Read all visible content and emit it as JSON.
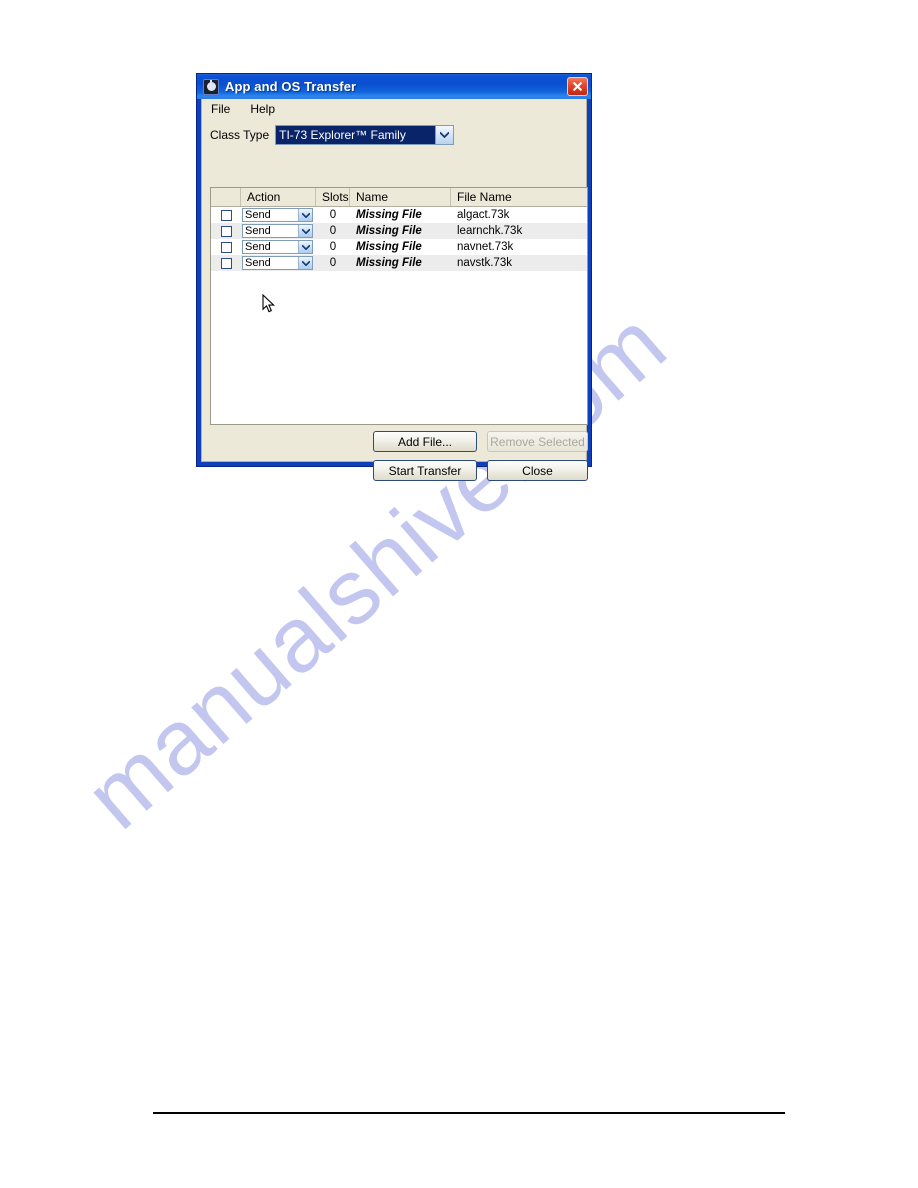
{
  "window": {
    "title": "App and OS Transfer",
    "app_icon": "app-circle-icon",
    "close_label": "close-icon",
    "titlebar_color": "#0b52d4",
    "border_color": "#0f3fba",
    "body_color": "#ece9d8"
  },
  "menubar": {
    "items": [
      {
        "label": "File"
      },
      {
        "label": "Help"
      }
    ]
  },
  "class_type": {
    "label": "Class Type",
    "selected": "TI-73 Explorer™ Family",
    "highlight_color": "#0a246a"
  },
  "list": {
    "columns": [
      {
        "key": "check",
        "header": ""
      },
      {
        "key": "action",
        "header": "Action"
      },
      {
        "key": "slots",
        "header": "Slots"
      },
      {
        "key": "name",
        "header": "Name"
      },
      {
        "key": "file",
        "header": "File Name"
      }
    ],
    "rows": [
      {
        "checked": false,
        "action": "Send",
        "slots": "0",
        "name": "Missing File",
        "file": "algact.73k"
      },
      {
        "checked": false,
        "action": "Send",
        "slots": "0",
        "name": "Missing File",
        "file": "learnchk.73k"
      },
      {
        "checked": false,
        "action": "Send",
        "slots": "0",
        "name": "Missing File",
        "file": "navnet.73k"
      },
      {
        "checked": false,
        "action": "Send",
        "slots": "0",
        "name": "Missing File",
        "file": "navstk.73k"
      }
    ]
  },
  "buttons": {
    "add_file": "Add File...",
    "remove_selected": "Remove Selected",
    "remove_selected_disabled": true,
    "start_transfer": "Start Transfer",
    "close": "Close"
  },
  "page": {
    "watermark": "manualshive.com",
    "watermark_color": "#c3c6ef"
  }
}
